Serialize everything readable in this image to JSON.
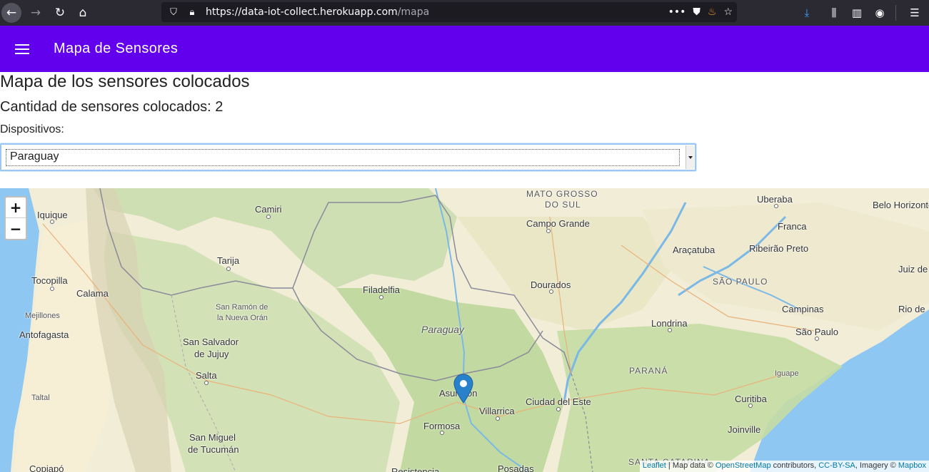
{
  "browser": {
    "url_main": "https://data-iot-collect.herokuapp.com",
    "url_path": "/mapa"
  },
  "appbar": {
    "title": "Mapa de Sensores"
  },
  "content": {
    "heading": "Mapa de los sensores colocados",
    "count_text": "Cantidad de sensores colocados: 2",
    "devices_label": "Dispositivos:",
    "device_selected": "Paraguay"
  },
  "map": {
    "zoom_in": "+",
    "zoom_out": "−",
    "attribution": {
      "leaflet": "Leaflet",
      "sep": " | Map data © ",
      "osm": "OpenStreetMap",
      "contrib": " contributors, ",
      "license": "CC-BY-SA",
      "imagery": ", Imagery © ",
      "mapbox": "Mapbox"
    },
    "labels": {
      "mato_grosso": "MATO GROSSO",
      "do_sul": "DO SUL",
      "uberaba": "Uberaba",
      "belo_horizonte": "Belo Horizonte",
      "iquique": "Iquique",
      "camiri": "Camiri",
      "campo_grande": "Campo Grande",
      "franca": "Franca",
      "aracatuba": "Araçatuba",
      "ribeirao_preto": "Ribeirão Preto",
      "tarija": "Tarija",
      "tocopilla": "Tocopilla",
      "calama": "Calama",
      "sao_paulo_state": "SÃO PAULO",
      "juiz_de": "Juiz de",
      "filadelfia": "Filadelfia",
      "dourados": "Dourados",
      "mejillones": "Mejillones",
      "san_ramon_1": "San Ramón de",
      "san_ramon_2": "la Nueva Orán",
      "campinas": "Campinas",
      "rio_de": "Rio de",
      "antofagasta": "Antofagasta",
      "paraguay": "Paraguay",
      "londrina": "Londrina",
      "sao_paulo": "São Paulo",
      "san_salvador_1": "San Salvador",
      "san_salvador_2": "de Jujuy",
      "parana": "PARANÁ",
      "iguape": "Iguape",
      "salta": "Salta",
      "taltal": "Taltal",
      "asuncion": "Asunción",
      "ciudad_del_este": "Ciudad del Este",
      "curitiba": "Curitiba",
      "villarrica": "Villarrica",
      "formosa": "Formosa",
      "joinville": "Joinville",
      "san_miguel_1": "San Miguel",
      "san_miguel_2": "de Tucumán",
      "copiapo": "Copiapó",
      "resistencia": "Resistencia",
      "posadas": "Posadas",
      "santa_catarina": "SANTA CATARINA"
    }
  },
  "colors": {
    "appbar": "#6200ee",
    "marker": "#2a81cb",
    "water": "#8ec7f2"
  }
}
